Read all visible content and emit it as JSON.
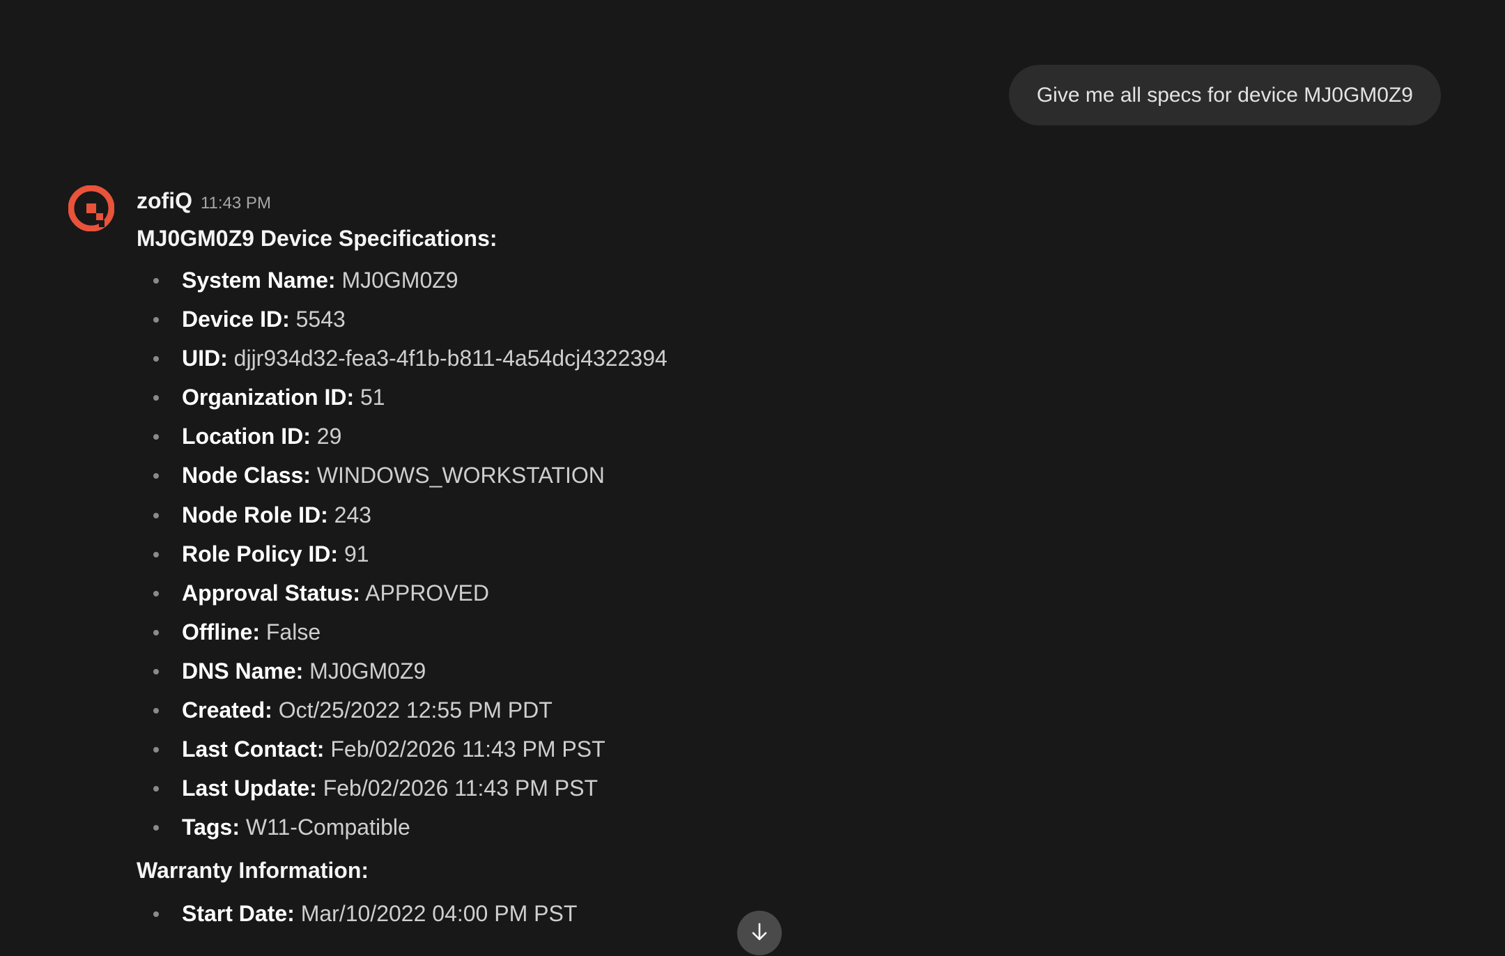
{
  "user_message": {
    "text": "Give me all specs for device MJ0GM0Z9"
  },
  "assistant": {
    "name": "zofiQ",
    "time": "11:43 PM",
    "avatar_icon": "zofiq-logo-icon",
    "avatar_color": "#E8533A",
    "title": "MJ0GM0Z9 Device Specifications:",
    "specs": [
      {
        "key": "System Name:",
        "value": "MJ0GM0Z9"
      },
      {
        "key": "Device ID:",
        "value": "5543"
      },
      {
        "key": "UID:",
        "value": "djjr934d32-fea3-4f1b-b811-4a54dcj4322394"
      },
      {
        "key": "Organization ID:",
        "value": "51"
      },
      {
        "key": "Location ID:",
        "value": "29"
      },
      {
        "key": "Node Class:",
        "value": "WINDOWS_WORKSTATION"
      },
      {
        "key": "Node Role ID:",
        "value": "243"
      },
      {
        "key": "Role Policy ID:",
        "value": "91"
      },
      {
        "key": "Approval Status:",
        "value": "APPROVED"
      },
      {
        "key": "Offline:",
        "value": "False"
      },
      {
        "key": "DNS Name:",
        "value": "MJ0GM0Z9"
      },
      {
        "key": "Created:",
        "value": "Oct/25/2022 12:55 PM PDT"
      },
      {
        "key": "Last Contact:",
        "value": "Feb/02/2026 11:43 PM PST"
      },
      {
        "key": "Last Update:",
        "value": "Feb/02/2026 11:43 PM PST"
      },
      {
        "key": "Tags:",
        "value": "W11-Compatible"
      }
    ],
    "warranty_title": "Warranty Information:",
    "warranty": [
      {
        "key": "Start Date:",
        "value": "Mar/10/2022 04:00 PM PST"
      }
    ]
  },
  "scroll_button": {
    "icon": "arrow-down-icon"
  }
}
